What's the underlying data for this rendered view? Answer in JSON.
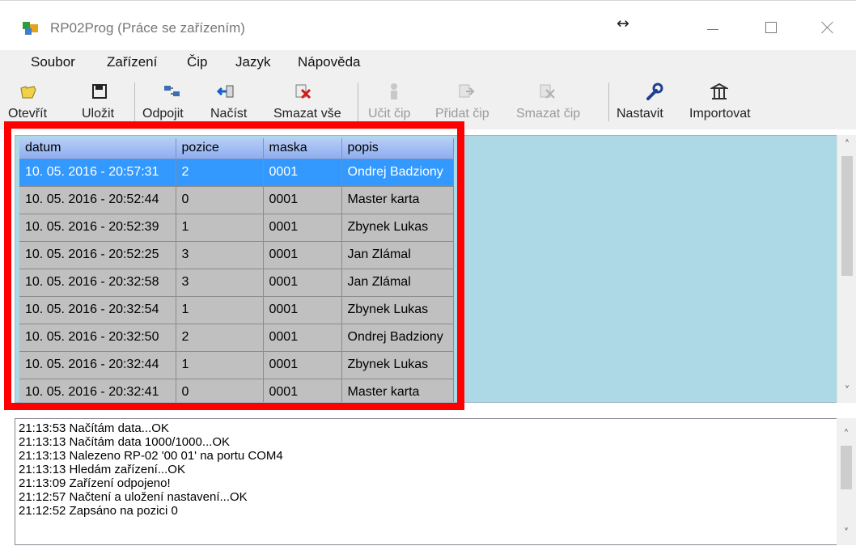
{
  "window": {
    "title": "RP02Prog (Práce se zařízením)",
    "resize_glyph": "↔",
    "colors": {
      "grid_background": "#add8e6",
      "selection": "#3399ff",
      "row": "#c0c0c0",
      "highlight": "#ff0000"
    }
  },
  "menu": [
    "Soubor",
    "Zařízení",
    "Čip",
    "Jazyk",
    "Nápověda"
  ],
  "toolbar": {
    "buttons": [
      {
        "label": "Otevřít",
        "icon": "folder-open-icon",
        "enabled": true
      },
      {
        "label": "Uložit",
        "icon": "save-disk-icon",
        "enabled": true
      },
      {
        "label": "Odpojit",
        "icon": "disconnect-icon",
        "enabled": true
      },
      {
        "label": "Načíst",
        "icon": "load-arrow-icon",
        "enabled": true
      },
      {
        "label": "Smazat vše",
        "icon": "delete-all-icon",
        "enabled": true
      },
      {
        "label": "Učit čip",
        "icon": "teach-chip-icon",
        "enabled": false
      },
      {
        "label": "Přidat čip",
        "icon": "add-chip-icon",
        "enabled": false
      },
      {
        "label": "Smazat čip",
        "icon": "delete-chip-icon",
        "enabled": false
      },
      {
        "label": "Nastavit",
        "icon": "wrench-icon",
        "enabled": true
      },
      {
        "label": "Importovat",
        "icon": "import-icon",
        "enabled": true
      }
    ]
  },
  "grid": {
    "columns": [
      "datum",
      "pozice",
      "maska",
      "popis"
    ],
    "rows": [
      [
        "10. 05. 2016 - 20:57:31",
        "2",
        "0001",
        "Ondrej Badziony"
      ],
      [
        "10. 05. 2016 - 20:52:44",
        "0",
        "0001",
        "Master karta"
      ],
      [
        "10. 05. 2016 - 20:52:39",
        "1",
        "0001",
        "Zbynek Lukas"
      ],
      [
        "10. 05. 2016 - 20:52:25",
        "3",
        "0001",
        "Jan Zlámal"
      ],
      [
        "10. 05. 2016 - 20:32:58",
        "3",
        "0001",
        "Jan Zlámal"
      ],
      [
        "10. 05. 2016 - 20:32:54",
        "1",
        "0001",
        "Zbynek Lukas"
      ],
      [
        "10. 05. 2016 - 20:32:50",
        "2",
        "0001",
        "Ondrej Badziony"
      ],
      [
        "10. 05. 2016 - 20:32:44",
        "1",
        "0001",
        "Zbynek Lukas"
      ],
      [
        "10. 05. 2016 - 20:32:41",
        "0",
        "0001",
        "Master karta"
      ]
    ],
    "selected_row": 0
  },
  "log": [
    "21:13:53  Načítám data...OK",
    "21:13:13  Načítám data 1000/1000...OK",
    "21:13:13  Nalezeno RP-02 '00 01' na portu COM4",
    "21:13:13  Hledám zařízení...OK",
    "21:13:09  Zařízení odpojeno!",
    "21:12:57  Načtení a uložení nastavení...OK",
    "21:12:52  Zapsáno na pozici 0"
  ],
  "scroll": {
    "up": "˄",
    "down": "˅"
  }
}
